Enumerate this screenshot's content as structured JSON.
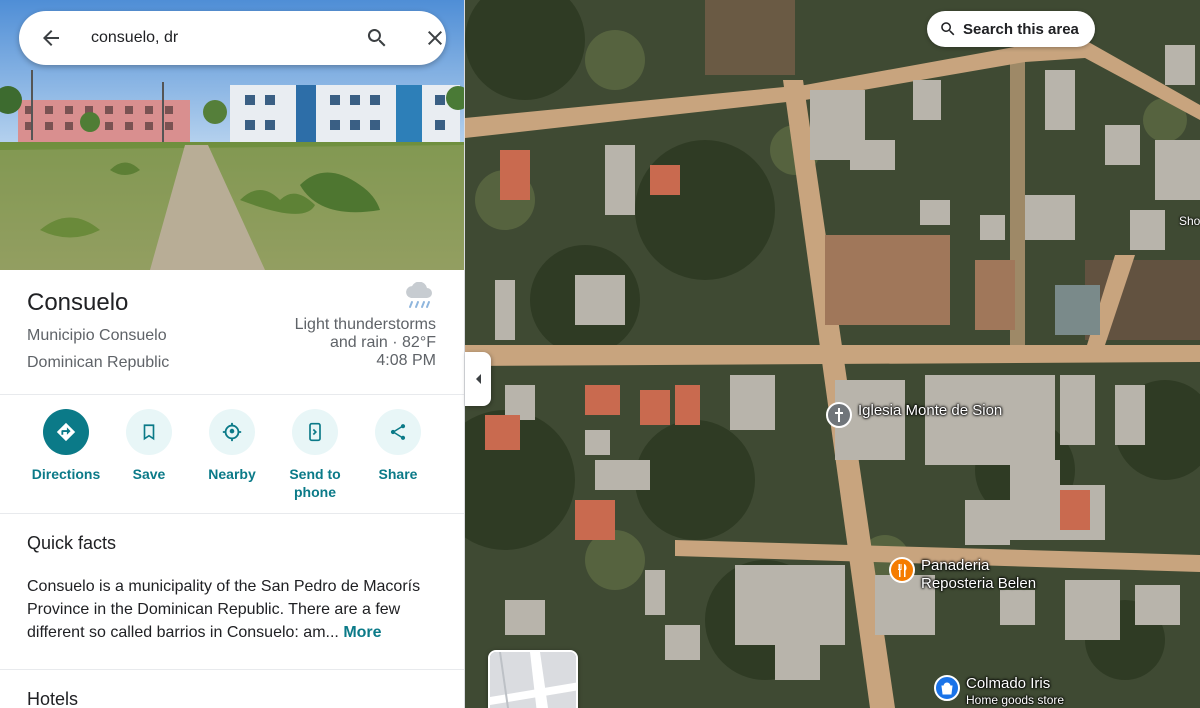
{
  "search": {
    "query": "consuelo, dr",
    "back_icon": "arrow-back-icon",
    "search_icon": "search-icon",
    "close_icon": "close-icon"
  },
  "place": {
    "title": "Consuelo",
    "subtitle_line1": "Municipio Consuelo",
    "subtitle_line2": "Dominican Republic"
  },
  "weather": {
    "icon": "thunderstorm-cloud-icon",
    "line1": "Light thunderstorms",
    "line2": "and rain · 82°F",
    "time": "4:08 PM"
  },
  "actions": [
    {
      "label": "Directions",
      "icon": "directions-icon"
    },
    {
      "label": "Save",
      "icon": "bookmark-icon"
    },
    {
      "label": "Nearby",
      "icon": "nearby-icon"
    },
    {
      "label": "Send to",
      "label2": "phone",
      "icon": "send-to-phone-icon"
    },
    {
      "label": "Share",
      "icon": "share-icon"
    }
  ],
  "quick_facts": {
    "title": "Quick facts",
    "text": "Consuelo is a municipality of the San Pedro de Macorís Province in the Dominican Republic. There are a few different so called barrios in Consuelo: am...",
    "more": "More"
  },
  "hotels": {
    "title": "Hotels"
  },
  "map": {
    "search_this_area": "Search this area",
    "edge_label": "Sho",
    "pois": [
      {
        "name": "Iglesia Monte de Sion",
        "icon": "church-icon"
      },
      {
        "name_line1": "Panaderia",
        "name_line2": "Reposteria Belen",
        "icon": "restaurant-icon"
      },
      {
        "name": "Colmado Iris",
        "category": "Home goods store",
        "icon": "shopping-bag-icon"
      }
    ]
  },
  "colors": {
    "accent": "#0b7a88",
    "accent_light": "#e8f6f7",
    "text_primary": "#202124",
    "text_secondary": "#5f6368",
    "poi_orange": "#f57c00",
    "poi_blue": "#1a73e8",
    "poi_gray": "#70757a"
  }
}
